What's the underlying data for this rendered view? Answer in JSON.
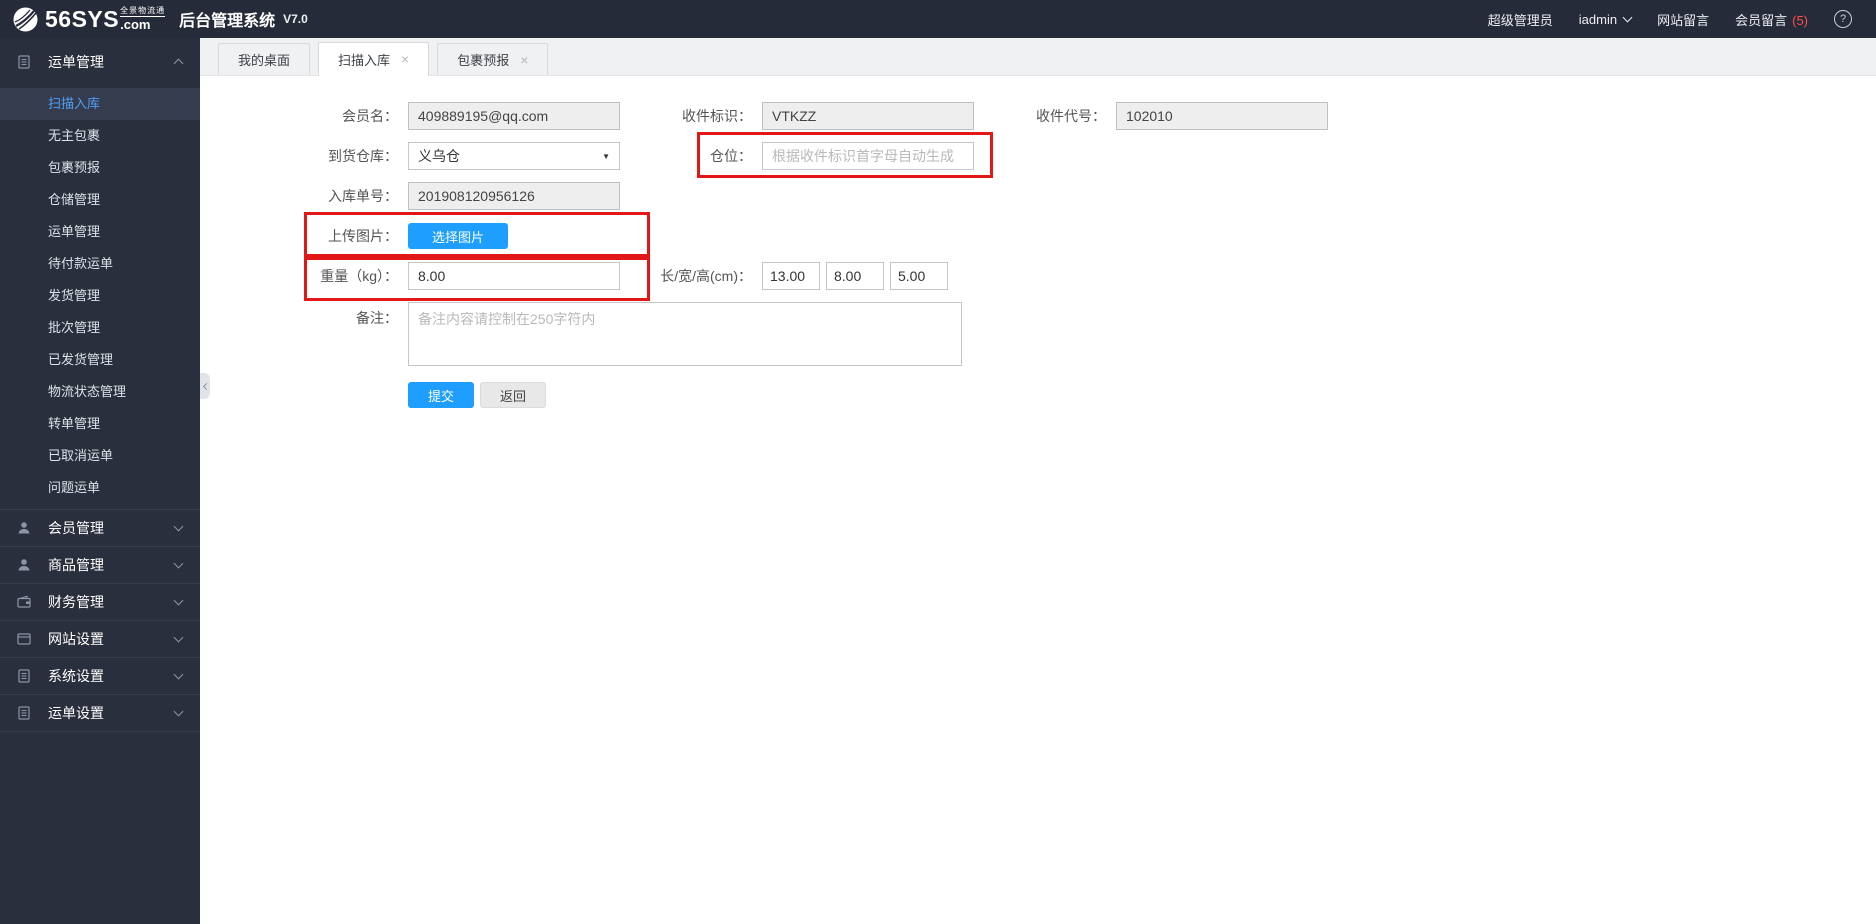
{
  "header": {
    "logo_main": "56SYS",
    "logo_cn": "全景物流通",
    "logo_com": ".com",
    "app_title": "后台管理系统",
    "version": "V7.0",
    "role": "超级管理员",
    "username": "iadmin",
    "site_messages": "网站留言",
    "member_messages": "会员留言",
    "member_message_count": "(5)",
    "help_glyph": "?"
  },
  "colors": {
    "header_bg": "#262b39",
    "sidebar_bg": "#2a2f3d",
    "accent_blue": "#1e9fff",
    "active_link_blue": "#4f9ef8",
    "highlight_red": "#e21717",
    "badge_red": "#ff4d4d"
  },
  "sidebar": {
    "groups": [
      {
        "label": "运单管理",
        "icon": "document-icon",
        "expanded": true,
        "items": [
          "扫描入库",
          "无主包裹",
          "包裹预报",
          "仓储管理",
          "运单管理",
          "待付款运单",
          "发货管理",
          "批次管理",
          "已发货管理",
          "物流状态管理",
          "转单管理",
          "已取消运单",
          "问题运单"
        ],
        "active_item": "扫描入库"
      },
      {
        "label": "会员管理",
        "icon": "user-icon",
        "expanded": false
      },
      {
        "label": "商品管理",
        "icon": "user-icon",
        "expanded": false
      },
      {
        "label": "财务管理",
        "icon": "wallet-icon",
        "expanded": false
      },
      {
        "label": "网站设置",
        "icon": "browser-icon",
        "expanded": false
      },
      {
        "label": "系统设置",
        "icon": "document-icon",
        "expanded": false
      },
      {
        "label": "运单设置",
        "icon": "document-icon",
        "expanded": false
      }
    ]
  },
  "tabs": {
    "close_glyph": "×",
    "items": [
      {
        "label": "我的桌面",
        "closable": false,
        "active": false
      },
      {
        "label": "扫描入库",
        "closable": true,
        "active": true
      },
      {
        "label": "包裹预报",
        "closable": true,
        "active": false
      }
    ]
  },
  "form": {
    "member_name": {
      "label": "会员名：",
      "value": "409889195@qq.com"
    },
    "receiver_mark": {
      "label": "收件标识：",
      "value": "VTKZZ"
    },
    "receiver_code": {
      "label": "收件代号：",
      "value": "102010"
    },
    "warehouse": {
      "label": "到货仓库：",
      "value": "义乌仓",
      "caret": "▼"
    },
    "bin_location": {
      "label": "仓位：",
      "placeholder": "根据收件标识首字母自动生成"
    },
    "inbound_no": {
      "label": "入库单号：",
      "value": "201908120956126"
    },
    "upload_image": {
      "label": "上传图片：",
      "button_label": "选择图片"
    },
    "weight": {
      "label": "重量（kg）：",
      "value": "8.00"
    },
    "dimensions": {
      "label": "长/宽/高(cm)：",
      "length": "13.00",
      "width": "8.00",
      "height": "5.00"
    },
    "remark": {
      "label": "备注：",
      "placeholder": "备注内容请控制在250字符内"
    },
    "submit_label": "提交",
    "back_label": "返回"
  }
}
